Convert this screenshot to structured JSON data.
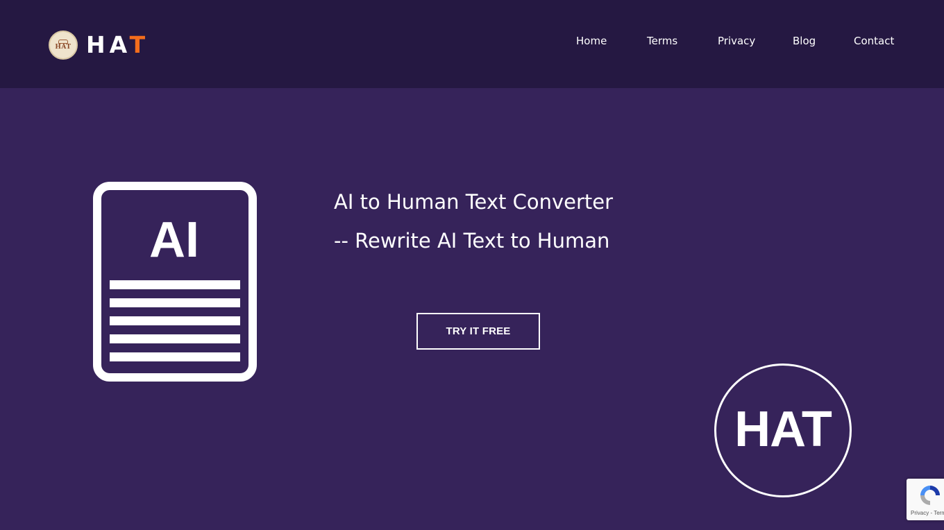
{
  "header": {
    "logo_badge_text": "HAT",
    "logo_text_main": "HA",
    "logo_text_accent": "T",
    "accent_color": "#f36d1c",
    "nav": [
      {
        "label": "Home"
      },
      {
        "label": "Terms"
      },
      {
        "label": "Privacy"
      },
      {
        "label": "Blog"
      },
      {
        "label": "Contact"
      }
    ]
  },
  "hero": {
    "doc_icon_label": "AI",
    "title_line1": "AI to Human Text Converter",
    "title_line2": "-- Rewrite AI Text to Human",
    "cta_label": "TRY IT FREE",
    "circle_logo_text": "HAT"
  },
  "recaptcha": {
    "links": "Privacy - Terms"
  },
  "colors": {
    "header_bg": "#251842",
    "page_bg": "#36235a"
  }
}
